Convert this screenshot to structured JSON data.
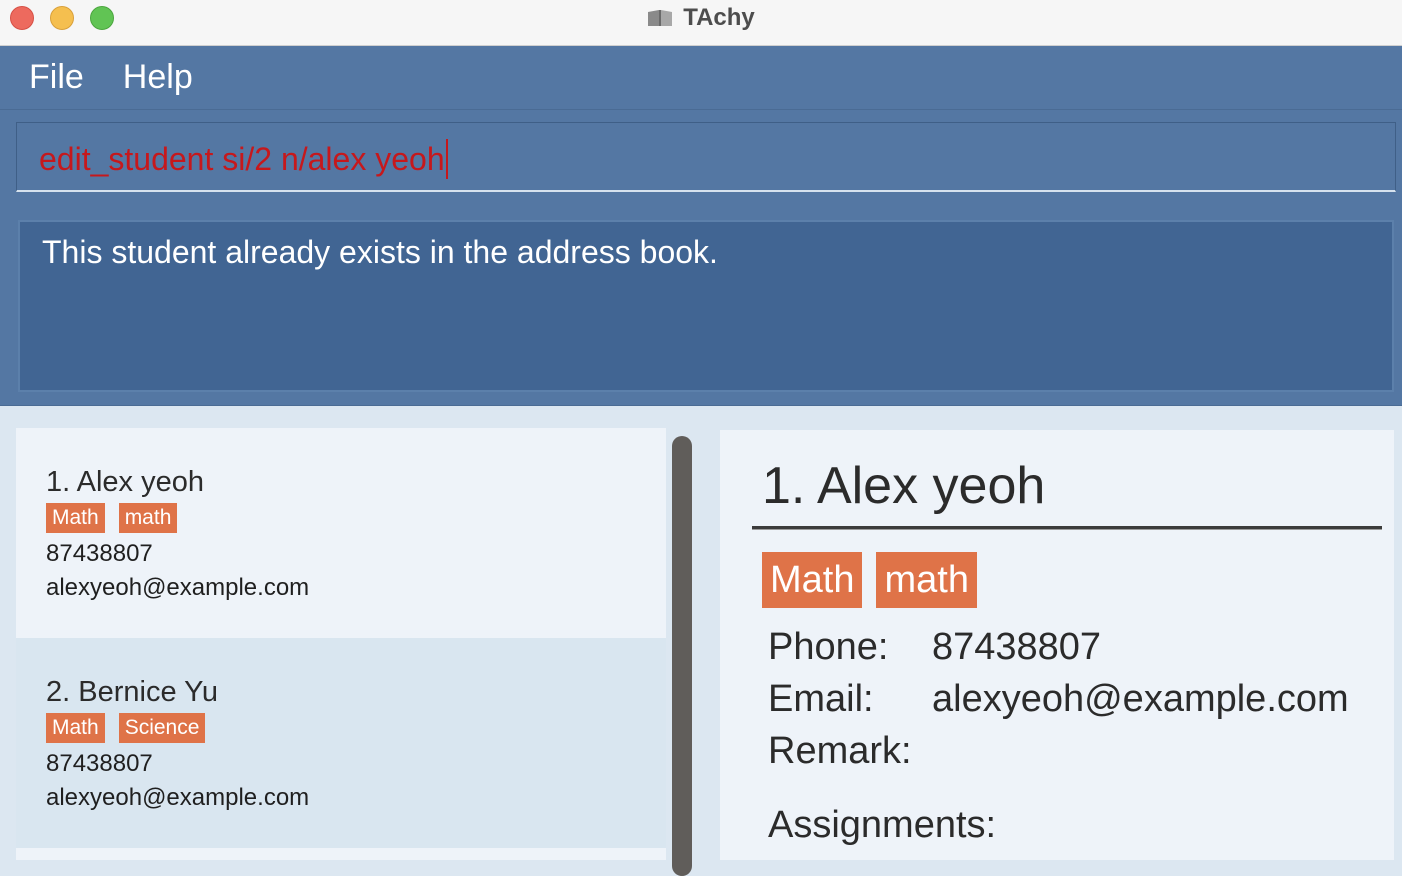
{
  "window": {
    "title": "TAchy",
    "app_icon": "open-book-icon"
  },
  "menu": {
    "items": [
      "File",
      "Help"
    ]
  },
  "command": {
    "value": "edit_student si/2 n/alex yeoh"
  },
  "result": {
    "message": "This student already exists in the address book."
  },
  "student_list": [
    {
      "name": "1. Alex yeoh",
      "tags": [
        "Math",
        "math"
      ],
      "phone": "87438807",
      "email": "alexyeoh@example.com"
    },
    {
      "name": "2. Bernice Yu",
      "tags": [
        "Math",
        "Science"
      ],
      "phone": "87438807",
      "email": "alexyeoh@example.com"
    }
  ],
  "detail": {
    "name": "1. Alex yeoh",
    "tags": [
      "Math",
      "math"
    ],
    "phone_label": "Phone:",
    "phone": "87438807",
    "email_label": "Email:",
    "email": "alexyeoh@example.com",
    "remark_label": "Remark:",
    "remark": "",
    "assignments_label": "Assignments:"
  },
  "colors": {
    "tag": "#df7348",
    "primary": "#5477a3",
    "error_text": "#c6181c"
  }
}
